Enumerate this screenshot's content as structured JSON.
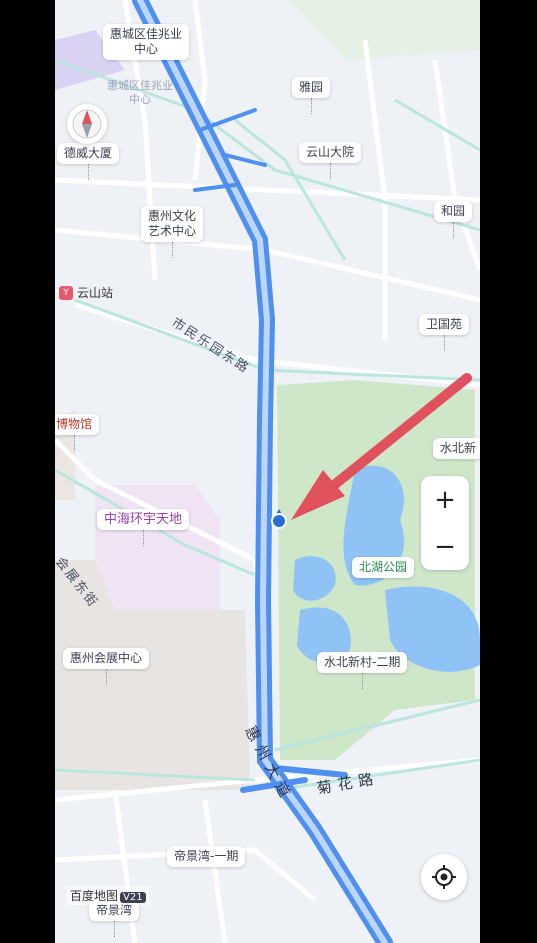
{
  "map": {
    "pois": [
      {
        "id": "huicheng-jiazhaoye",
        "label": "惠城区佳兆业\n中心",
        "style": "plain"
      },
      {
        "id": "dewei",
        "label": "德威大厦",
        "style": "plain"
      },
      {
        "id": "yayuan",
        "label": "雅园",
        "style": "plain"
      },
      {
        "id": "yunshan-dayuan",
        "label": "云山大院",
        "style": "plain"
      },
      {
        "id": "heyuan",
        "label": "和园",
        "style": "plain"
      },
      {
        "id": "huizhou-culture",
        "label": "惠州文化\n艺术中心",
        "style": "plain"
      },
      {
        "id": "weiwei",
        "label": "卫国苑",
        "style": "plain"
      },
      {
        "id": "museum",
        "label": "博物馆",
        "style": "red"
      },
      {
        "id": "shuibei-right",
        "label": "水北新",
        "style": "plain"
      },
      {
        "id": "zhonghai",
        "label": "中海环宇天地",
        "style": "purple"
      },
      {
        "id": "beihu-park",
        "label": "北湖公园",
        "style": "green"
      },
      {
        "id": "huizhou-expo",
        "label": "惠州会展中心",
        "style": "plain"
      },
      {
        "id": "shuibei-village",
        "label": "水北新村-二期",
        "style": "plain"
      },
      {
        "id": "dijingwan-1",
        "label": "帝景湾-一期",
        "style": "plain"
      },
      {
        "id": "dijingwan",
        "label": "帝景湾",
        "style": "plain"
      }
    ],
    "ghost_label": "惠城区佳兆业\n中心",
    "station": {
      "icon": "Y",
      "label": "云山站"
    },
    "roads": {
      "shimin": "市民乐园东路",
      "huizhan": "会展东街",
      "huizhou_avenue": "惠州大道",
      "juhua": "菊花路"
    },
    "brand": {
      "name": "百度地图",
      "version": "V21"
    },
    "controls": {
      "zoom_in": "+",
      "zoom_out": "−"
    },
    "colors": {
      "route": "#4f8ff0",
      "route_core": "#bcd6fb",
      "arrow": "#e0515e",
      "park": "#cfe7c9",
      "water": "#8fc3f5"
    }
  }
}
